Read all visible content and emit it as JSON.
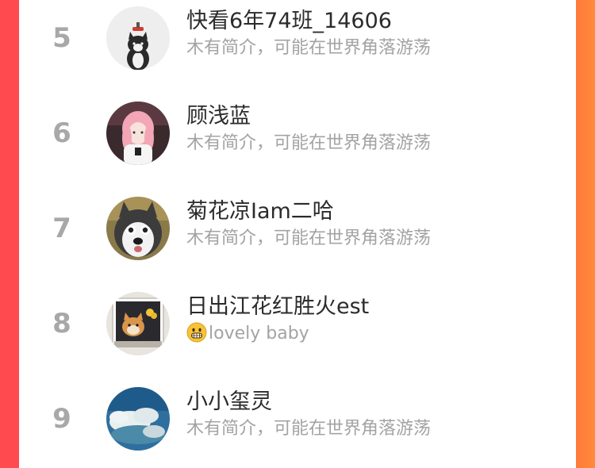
{
  "list": {
    "items": [
      {
        "rank": "5",
        "name": "快看6年74班_14606",
        "bio": "木有简介，可能在世界角落游荡",
        "avatar": "cat-avatar",
        "bio_emoji": ""
      },
      {
        "rank": "6",
        "name": "顾浅蓝",
        "bio": "木有简介，可能在世界角落游荡",
        "avatar": "girl-avatar",
        "bio_emoji": ""
      },
      {
        "rank": "7",
        "name": "菊花凉Iam二哈",
        "bio": "木有简介，可能在世界角落游荡",
        "avatar": "husky-avatar",
        "bio_emoji": ""
      },
      {
        "rank": "8",
        "name": "日出江花红胜火est",
        "bio": "lovely baby",
        "avatar": "dog-frame-avatar",
        "bio_emoji": "grinning-face-icon"
      },
      {
        "rank": "9",
        "name": "小小玺灵",
        "bio": "木有简介，可能在世界角落游荡",
        "avatar": "sky-avatar",
        "bio_emoji": ""
      }
    ]
  },
  "colors": {
    "left_edge": "#ff4a4f",
    "right_edge": "#ff7a3c",
    "rank_gray": "#a8a8a8",
    "name_text": "#2b2b2b",
    "bio_text": "#a3a3a3"
  }
}
